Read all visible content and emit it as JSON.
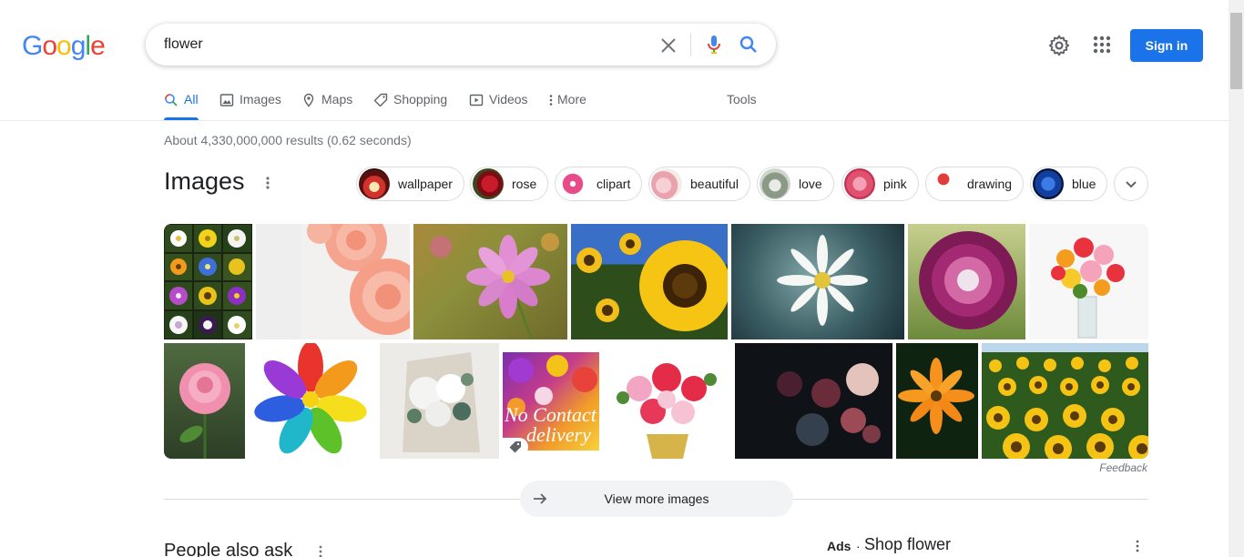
{
  "logo": {
    "letters": [
      "G",
      "o",
      "o",
      "g",
      "l",
      "e"
    ],
    "colors": [
      "#4285f4",
      "#ea4335",
      "#fbbc05",
      "#4285f4",
      "#34a853",
      "#ea4335"
    ]
  },
  "search": {
    "query": "flower"
  },
  "header": {
    "sign_in": "Sign in"
  },
  "tabs": [
    {
      "label": "All",
      "icon": "search-icon",
      "active": true
    },
    {
      "label": "Images",
      "icon": "image-icon"
    },
    {
      "label": "Maps",
      "icon": "map-pin-icon"
    },
    {
      "label": "Shopping",
      "icon": "tag-icon"
    },
    {
      "label": "Videos",
      "icon": "play-icon"
    },
    {
      "label": "More",
      "icon": "kebab-icon"
    },
    {
      "label": "Tools"
    }
  ],
  "result_stats": "About 4,330,000,000 results (0.62 seconds)",
  "images_section": {
    "title": "Images",
    "chips": [
      "wallpaper",
      "rose",
      "clipart",
      "beautiful",
      "love",
      "pink",
      "drawing",
      "blue"
    ],
    "tiles": [
      {
        "subject": "flower-grid"
      },
      {
        "subject": "peach-ranunculus"
      },
      {
        "subject": "pink-cosmos"
      },
      {
        "subject": "sunflower"
      },
      {
        "subject": "white-daisy"
      },
      {
        "subject": "purple-dahlia"
      },
      {
        "subject": "gerbera-bouquet"
      },
      {
        "subject": "pink-rose"
      },
      {
        "subject": "rainbow-flower"
      },
      {
        "subject": "white-bouquet"
      },
      {
        "subject": "no-contact-delivery",
        "overlay_lines": [
          "No Contact",
          "delivery"
        ]
      },
      {
        "subject": "red-pink-arrangement"
      },
      {
        "subject": "dark-roses"
      },
      {
        "subject": "orange-flower"
      },
      {
        "subject": "sunflower-field"
      }
    ],
    "feedback": "Feedback",
    "view_more": "View more images"
  },
  "people_also_ask": {
    "title": "People also ask"
  },
  "ads": {
    "label": "Ads",
    "separator": "·",
    "title": "Shop flower"
  },
  "colors": {
    "accent": "#1a73e8",
    "muted": "#70757a",
    "border": "#dadce0"
  }
}
